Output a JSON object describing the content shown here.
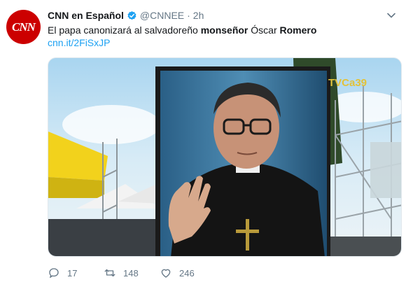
{
  "author": {
    "name": "CNN en Español",
    "handle": "@CNNEE",
    "separator": "·",
    "time": "2h",
    "avatar_logo": "CNN"
  },
  "tweet": {
    "text_part1": "El papa canonizará al salvadoreño ",
    "text_bold1": "monseñor",
    "text_part2": " Óscar ",
    "text_bold2": "Romero",
    "link": "cnn.it/2FiSxJP"
  },
  "media": {
    "watermark": "TVCa39"
  },
  "actions": {
    "reply_count": "17",
    "retweet_count": "148",
    "like_count": "246"
  },
  "colors": {
    "brand_red": "#cc0000",
    "link_blue": "#1da1f2",
    "verified_blue": "#1da1f2",
    "muted": "#657786"
  },
  "icons": {
    "verified": "verified-badge-icon",
    "caret": "chevron-down-icon",
    "reply": "reply-icon",
    "retweet": "retweet-icon",
    "like": "heart-icon"
  }
}
